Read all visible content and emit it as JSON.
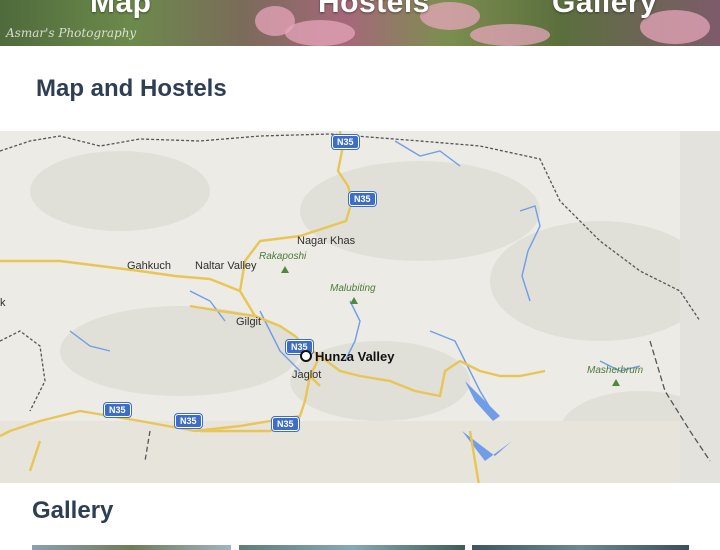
{
  "banner": {
    "tabs": [
      {
        "label": "Map"
      },
      {
        "label": "Hostels"
      },
      {
        "label": "Gallery"
      }
    ],
    "watermark": "Asmar's Photography"
  },
  "map_section": {
    "title": "Map and Hostels",
    "marker": {
      "label": "Hunza Valley"
    },
    "places": [
      "Nagar Khas",
      "Gahkuch",
      "Naltar Valley",
      "Gilgit",
      "Jaglot",
      "k"
    ],
    "parks": [
      "Rakaposhi",
      "Malubiting",
      "Masherbrum"
    ],
    "road_shields": [
      "N35",
      "N35",
      "N35",
      "N35",
      "N35",
      "N35"
    ],
    "colors": {
      "water": "#6f9de8",
      "road": "#e9c556",
      "shield": "#3d6dc6",
      "land": "#ecebe5"
    }
  },
  "gallery_section": {
    "title": "Gallery"
  }
}
